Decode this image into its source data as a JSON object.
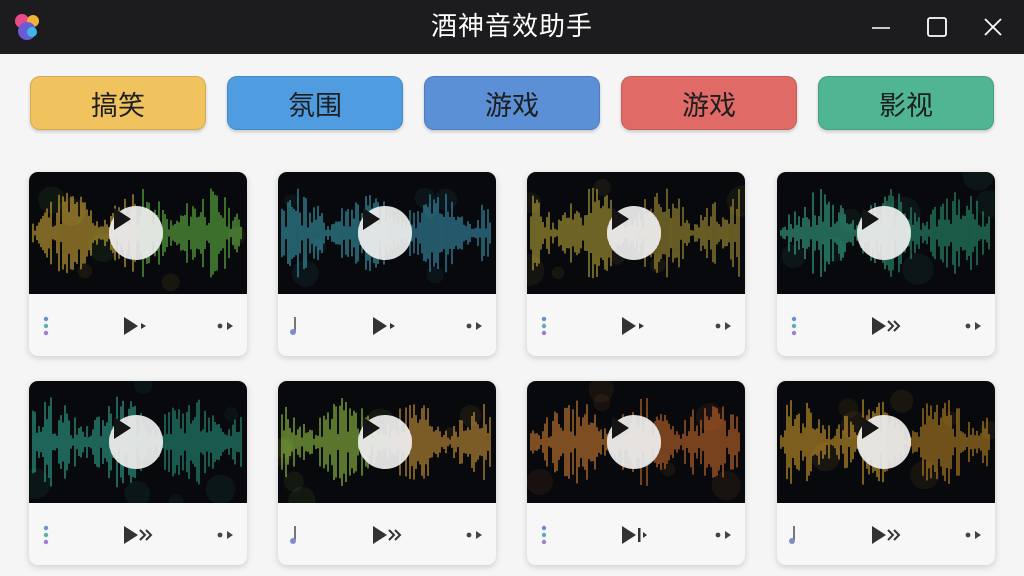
{
  "window": {
    "title": "酒神音效助手"
  },
  "categories": [
    {
      "label": "搞笑",
      "color": "#f0c35e"
    },
    {
      "label": "氛围",
      "color": "#4f9de0"
    },
    {
      "label": "游戏",
      "color": "#5b8fd6"
    },
    {
      "label": "游戏",
      "color": "#e06a66"
    },
    {
      "label": "影视",
      "color": "#4fb592"
    }
  ],
  "cards": [
    {
      "wave": [
        "#e1b53c",
        "#6bc54a"
      ],
      "play_icon": "play-next-icon",
      "left_icon": "dots-vertical-icon"
    },
    {
      "wave": [
        "#3fa9bc",
        "#3c9dba"
      ],
      "play_icon": "play-next-icon",
      "left_icon": "music-note-icon"
    },
    {
      "wave": [
        "#c7b23d",
        "#b7a23a"
      ],
      "play_icon": "play-next-icon",
      "left_icon": "dots-vertical-icon"
    },
    {
      "wave": [
        "#3cb893",
        "#2ea07e"
      ],
      "play_icon": "fast-forward-icon",
      "left_icon": "dots-vertical-icon"
    },
    {
      "wave": [
        "#33b39b",
        "#2c9f87"
      ],
      "play_icon": "fast-forward-icon",
      "left_icon": "dots-vertical-icon"
    },
    {
      "wave": [
        "#9fd44a",
        "#e0a33c"
      ],
      "play_icon": "fast-forward-icon",
      "left_icon": "music-note-icon"
    },
    {
      "wave": [
        "#e08a35",
        "#d6722d"
      ],
      "play_icon": "skip-next-icon",
      "left_icon": "dots-vertical-icon"
    },
    {
      "wave": [
        "#e0a830",
        "#c98f26"
      ],
      "play_icon": "fast-forward-icon",
      "left_icon": "music-note-icon"
    }
  ]
}
